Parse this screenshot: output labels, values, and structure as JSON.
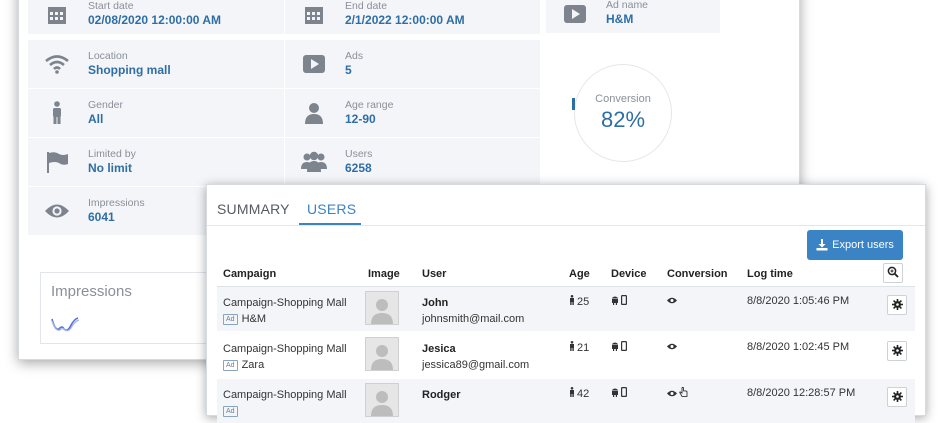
{
  "info": {
    "start_date": {
      "label": "Start date",
      "value": "02/08/2020 12:00:00 AM"
    },
    "end_date": {
      "label": "End date",
      "value": "2/1/2022 12:00:00 AM"
    },
    "location": {
      "label": "Location",
      "value": "Shopping mall"
    },
    "ads": {
      "label": "Ads",
      "value": "5"
    },
    "gender": {
      "label": "Gender",
      "value": "All"
    },
    "age_range": {
      "label": "Age range",
      "value": "12-90"
    },
    "limited_by": {
      "label": "Limited by",
      "value": "No limit"
    },
    "users": {
      "label": "Users",
      "value": "6258"
    },
    "impressions": {
      "label": "Impressions",
      "value": "6041"
    },
    "ad_name": {
      "label": "Ad name",
      "value": "H&M"
    }
  },
  "conversion": {
    "label": "Conversion",
    "value": "82%"
  },
  "impressions_card": {
    "title": "Impressions"
  },
  "tabs": {
    "summary": "SUMMARY",
    "users": "USERS"
  },
  "export_button": "Export users",
  "table": {
    "headers": {
      "campaign": "Campaign",
      "image": "Image",
      "user": "User",
      "age": "Age",
      "device": "Device",
      "conversion": "Conversion",
      "log_time": "Log time"
    },
    "rows": [
      {
        "campaign": "Campaign-Shopping Mall",
        "ad_tag": "Ad",
        "ad": "H&M",
        "name": "John",
        "email": "johnsmith@mail.com",
        "age": "25",
        "log_time": "8/8/2020 1:05:46 PM"
      },
      {
        "campaign": "Campaign-Shopping Mall",
        "ad_tag": "Ad",
        "ad": "Zara",
        "name": "Jesica",
        "email": "jessica89@gmail.com",
        "age": "21",
        "log_time": "8/8/2020 1:02:45 PM"
      },
      {
        "campaign": "Campaign-Shopping Mall",
        "ad_tag": "Ad",
        "ad": "",
        "name": "Rodger",
        "email": "",
        "age": "42",
        "log_time": "8/8/2020 12:28:57 PM"
      }
    ]
  },
  "colors": {
    "accent": "#3a83c4",
    "value_text": "#2f6ea5",
    "panel": "#f3f5f8"
  }
}
